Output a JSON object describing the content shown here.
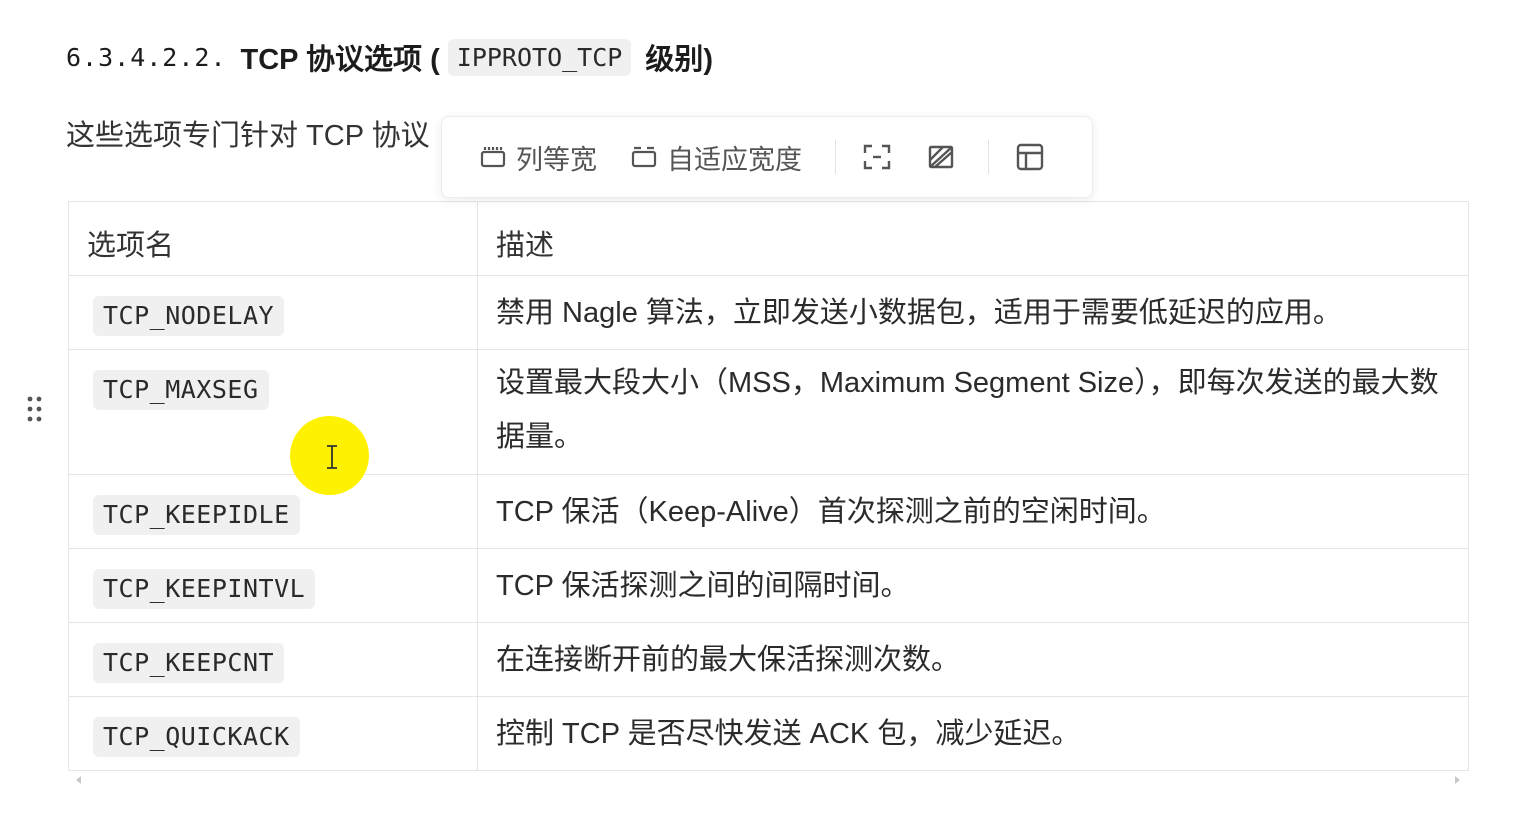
{
  "heading": {
    "number": "6.3.4.2.2.",
    "title_prefix": "TCP 协议选项 (",
    "code": "IPPROTO_TCP",
    "title_suffix": "级别)"
  },
  "intro": "这些选项专门针对 TCP 协议",
  "toolbar": {
    "equal_width_label": "列等宽",
    "auto_width_label": "自适应宽度",
    "icons": [
      "fullscreen-icon",
      "no-format-icon",
      "table-layout-icon"
    ]
  },
  "table": {
    "headers": [
      "选项名",
      "描述"
    ],
    "rows": [
      {
        "name": "TCP_NODELAY",
        "desc": "禁用 Nagle 算法，立即发送小数据包，适用于需要低延迟的应用。"
      },
      {
        "name": "TCP_MAXSEG",
        "desc": "设置最大段大小（MSS，Maximum Segment Size），即每次发送的最大数据量。"
      },
      {
        "name": "TCP_KEEPIDLE",
        "desc": "TCP 保活（Keep-Alive）首次探测之前的空闲时间。"
      },
      {
        "name": "TCP_KEEPINTVL",
        "desc": "TCP 保活探测之间的间隔时间。"
      },
      {
        "name": "TCP_KEEPCNT",
        "desc": "在连接断开前的最大保活探测次数。"
      },
      {
        "name": "TCP_QUICKACK",
        "desc": "控制 TCP 是否尽快发送 ACK 包，减少延迟。"
      }
    ]
  },
  "colors": {
    "cursor_highlight": "#fff200",
    "code_background": "#f0f0f0",
    "border": "#e5e5e5"
  }
}
